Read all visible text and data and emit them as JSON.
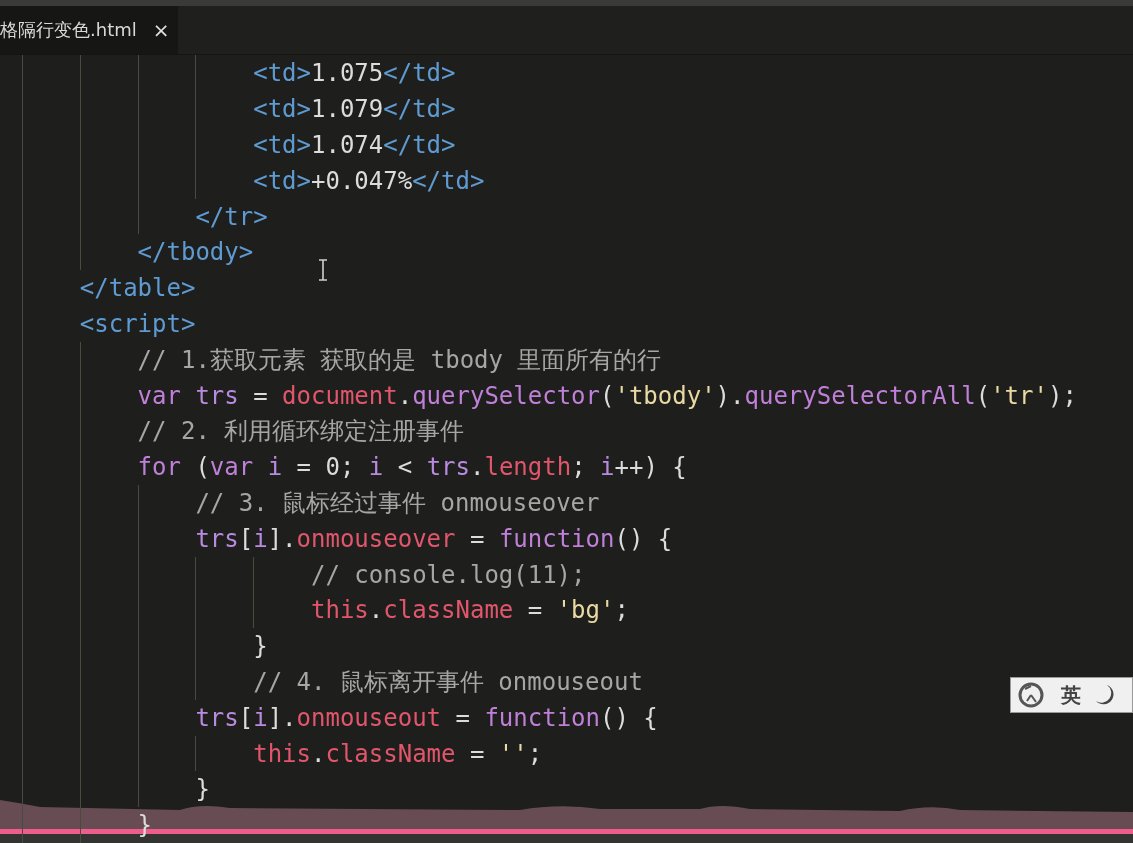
{
  "tab": {
    "title": "格隔行变色.html",
    "close": "×"
  },
  "code_lines": [
    {
      "tokens": [
        {
          "kind": "tag",
          "text": "                <td>"
        },
        {
          "kind": "text",
          "text": "1.075"
        },
        {
          "kind": "tag",
          "text": "</td>"
        }
      ]
    },
    {
      "tokens": [
        {
          "kind": "tag",
          "text": "                <td>"
        },
        {
          "kind": "text",
          "text": "1.079"
        },
        {
          "kind": "tag",
          "text": "</td>"
        }
      ]
    },
    {
      "tokens": [
        {
          "kind": "tag",
          "text": "                <td>"
        },
        {
          "kind": "text",
          "text": "1.074"
        },
        {
          "kind": "tag",
          "text": "</td>"
        }
      ]
    },
    {
      "tokens": [
        {
          "kind": "tag",
          "text": "                <td>"
        },
        {
          "kind": "text",
          "text": "+0.047%"
        },
        {
          "kind": "tag",
          "text": "</td>"
        }
      ]
    },
    {
      "tokens": [
        {
          "kind": "tag",
          "text": "            </tr>"
        }
      ]
    },
    {
      "tokens": [
        {
          "kind": "tag",
          "text": "        </tbody>"
        }
      ]
    },
    {
      "tokens": [
        {
          "kind": "tag",
          "text": "    </table>"
        }
      ]
    },
    {
      "tokens": [
        {
          "kind": "tag",
          "text": "    <script>"
        }
      ]
    },
    {
      "tokens": [
        {
          "kind": "comment",
          "text": "        // 1.获取元素 获取的是 tbody 里面所有的行"
        }
      ]
    },
    {
      "tokens": [
        {
          "kind": "keyword",
          "text": "        var"
        },
        {
          "kind": "variable",
          "text": " trs"
        },
        {
          "kind": "text",
          "text": " = "
        },
        {
          "kind": "property",
          "text": "document"
        },
        {
          "kind": "text",
          "text": "."
        },
        {
          "kind": "method",
          "text": "querySelector"
        },
        {
          "kind": "text",
          "text": "("
        },
        {
          "kind": "string",
          "text": "'tbody'"
        },
        {
          "kind": "text",
          "text": ")."
        },
        {
          "kind": "method",
          "text": "querySelectorAll"
        },
        {
          "kind": "text",
          "text": "("
        },
        {
          "kind": "string",
          "text": "'tr'"
        },
        {
          "kind": "text",
          "text": ");"
        }
      ]
    },
    {
      "tokens": [
        {
          "kind": "comment",
          "text": "        // 2. 利用循环绑定注册事件"
        }
      ]
    },
    {
      "tokens": [
        {
          "kind": "keyword",
          "text": "        for"
        },
        {
          "kind": "text",
          "text": " ("
        },
        {
          "kind": "keyword",
          "text": "var"
        },
        {
          "kind": "variable",
          "text": " i"
        },
        {
          "kind": "text",
          "text": " = 0; "
        },
        {
          "kind": "variable",
          "text": "i"
        },
        {
          "kind": "text",
          "text": " < "
        },
        {
          "kind": "variable",
          "text": "trs"
        },
        {
          "kind": "text",
          "text": "."
        },
        {
          "kind": "property",
          "text": "length"
        },
        {
          "kind": "text",
          "text": "; "
        },
        {
          "kind": "variable",
          "text": "i"
        },
        {
          "kind": "text",
          "text": "++) {"
        }
      ]
    },
    {
      "tokens": [
        {
          "kind": "comment",
          "text": "            // 3. 鼠标经过事件 onmouseover"
        }
      ]
    },
    {
      "tokens": [
        {
          "kind": "variable",
          "text": "            trs"
        },
        {
          "kind": "text",
          "text": "["
        },
        {
          "kind": "variable",
          "text": "i"
        },
        {
          "kind": "text",
          "text": "]."
        },
        {
          "kind": "property",
          "text": "onmouseover"
        },
        {
          "kind": "text",
          "text": " = "
        },
        {
          "kind": "keyword",
          "text": "function"
        },
        {
          "kind": "text",
          "text": "() {"
        }
      ]
    },
    {
      "tokens": [
        {
          "kind": "comment",
          "text": "                    // console.log(11);"
        }
      ]
    },
    {
      "tokens": [
        {
          "kind": "property",
          "text": "                    this"
        },
        {
          "kind": "text",
          "text": "."
        },
        {
          "kind": "property",
          "text": "className"
        },
        {
          "kind": "text",
          "text": " = "
        },
        {
          "kind": "string",
          "text": "'bg'"
        },
        {
          "kind": "text",
          "text": ";"
        }
      ]
    },
    {
      "tokens": [
        {
          "kind": "text",
          "text": "                }"
        }
      ]
    },
    {
      "tokens": [
        {
          "kind": "comment",
          "text": "                // 4. 鼠标离开事件 onmouseout"
        }
      ]
    },
    {
      "tokens": [
        {
          "kind": "variable",
          "text": "            trs"
        },
        {
          "kind": "text",
          "text": "["
        },
        {
          "kind": "variable",
          "text": "i"
        },
        {
          "kind": "text",
          "text": "]."
        },
        {
          "kind": "property",
          "text": "onmouseout"
        },
        {
          "kind": "text",
          "text": " = "
        },
        {
          "kind": "keyword",
          "text": "function"
        },
        {
          "kind": "text",
          "text": "() {"
        }
      ]
    },
    {
      "tokens": [
        {
          "kind": "property",
          "text": "                this"
        },
        {
          "kind": "text",
          "text": "."
        },
        {
          "kind": "property",
          "text": "className"
        },
        {
          "kind": "text",
          "text": " = "
        },
        {
          "kind": "string",
          "text": "''"
        },
        {
          "kind": "text",
          "text": ";"
        }
      ]
    },
    {
      "tokens": [
        {
          "kind": "text",
          "text": "            }"
        }
      ]
    },
    {
      "tokens": [
        {
          "kind": "text",
          "text": "        }"
        }
      ]
    }
  ],
  "ime": {
    "mode": "英"
  }
}
